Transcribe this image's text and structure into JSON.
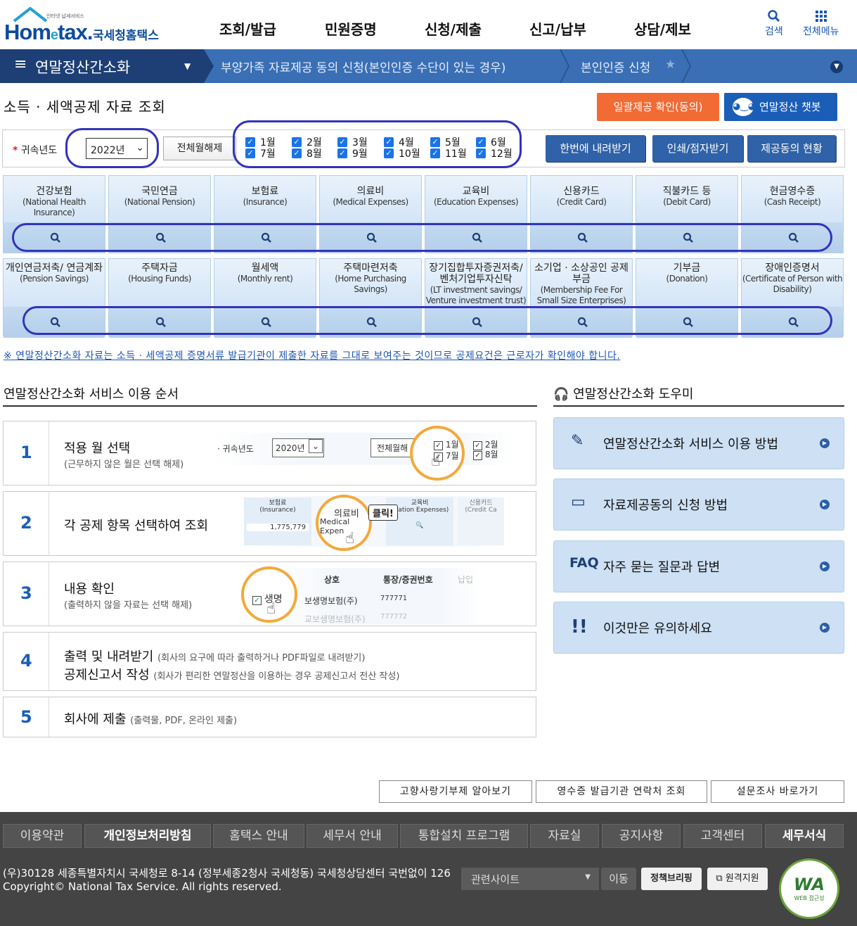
{
  "header": {
    "logo_sub": "인터넷 납세서비스",
    "logo_brand_a": "Hom",
    "logo_brand_e": "e",
    "logo_brand_b": "tax.",
    "logo_kr": "국세청홈택스",
    "menu": [
      "조회/발급",
      "민원증명",
      "신청/제출",
      "신고/납부",
      "상담/제보"
    ],
    "search_label": "검색",
    "allmenu_label": "전체메뉴"
  },
  "nav": {
    "current": "연말정산간소화",
    "crumbs": [
      "부양가족 자료제공 동의 신청(본인인증 수단이 있는 경우)",
      "본인인증 신청"
    ]
  },
  "page": {
    "title": "소득 · 세액공제 자료 조회",
    "bulk_confirm_button": "일괄제공 확인(동의)",
    "chatbot_button": "연말정산 챗봇"
  },
  "filter": {
    "year_label": "귀속년도",
    "year_value": "2022년",
    "all_off_button": "전체월해제",
    "months": [
      "1월",
      "2월",
      "3월",
      "4월",
      "5월",
      "6월",
      "7월",
      "8월",
      "9월",
      "10월",
      "11월",
      "12월"
    ],
    "download_all_button": "한번에 내려받기",
    "print_button": "인쇄/점자받기",
    "consent_status_button": "제공동의 현황"
  },
  "categories_row1": [
    {
      "kr": "건강보험",
      "en": "(National Health Insurance)"
    },
    {
      "kr": "국민연금",
      "en": "(National Pension)"
    },
    {
      "kr": "보험료",
      "en": "(Insurance)"
    },
    {
      "kr": "의료비",
      "en": "(Medical Expenses)"
    },
    {
      "kr": "교육비",
      "en": "(Education Expenses)"
    },
    {
      "kr": "신용카드",
      "en": "(Credit Card)"
    },
    {
      "kr": "직불카드 등",
      "en": "(Debit Card)"
    },
    {
      "kr": "현금영수증",
      "en": "(Cash Receipt)"
    }
  ],
  "categories_row2": [
    {
      "kr": "개인연금저축/ 연금계좌",
      "en": "(Pension Savings)"
    },
    {
      "kr": "주택자금",
      "en": "(Housing Funds)"
    },
    {
      "kr": "월세액",
      "en": "(Monthly rent)"
    },
    {
      "kr": "주택마련저축",
      "en": "(Home Purchasing Savings)"
    },
    {
      "kr": "장기집합투자증권저축/ 벤처기업투자신탁",
      "en": "(LT investment savings/ Venture investment trust)"
    },
    {
      "kr": "소기업 · 소상공인 공제부금",
      "en": "(Membership Fee For Small Size Enterprises)"
    },
    {
      "kr": "기부금",
      "en": "(Donation)"
    },
    {
      "kr": "장애인증명서",
      "en": "(Certificate of Person with Disability)"
    }
  ],
  "notice": "※ 연말정산간소화 자료는 소득 · 세액공제 증명서류 발급기관이 제출한 자료를 그대로 보여주는 것이므로 공제요건은 근로자가 확인해야 합니다.",
  "steps_title": "연말정산간소화 서비스 이용 순서",
  "steps": [
    {
      "num": "1",
      "title": "적용 월 선택",
      "desc": "(근무하지 않은 월은 선택 해제)"
    },
    {
      "num": "2",
      "title": "각 공제 항목 선택하여 조회",
      "desc": ""
    },
    {
      "num": "3",
      "title": "내용 확인",
      "desc": "(출력하지 않을 자료는 선택 해제)"
    },
    {
      "num": "4",
      "title": "출력 및 내려받기",
      "title2": "공제신고서 작성",
      "desc": "(회사의 요구에 따라 출력하거나 PDF파일로 내려받기)",
      "desc2": "(회사가 편리한 연말정산을 이용하는 경우 공제신고서 전산 작성)"
    },
    {
      "num": "5",
      "title": "회사에 제출",
      "desc": "(출력물, PDF, 온라인 제출)"
    }
  ],
  "illustrations": {
    "s1_year_label": "· 귀속년도",
    "s1_year": "2020년",
    "s1_alloff": "전체월해",
    "s1_m1": "1월",
    "s1_m7": "7월",
    "s1_m2": "2월",
    "s1_m8": "8월",
    "s2_c1_kr": "보험료",
    "s2_c1_en": "(Insurance)",
    "s2_c1_val": "1,775,779",
    "s2_c2_kr": "의료비",
    "s2_c2_en": "Medical Expen",
    "s2_click": "클릭!",
    "s2_c3_kr": "교육비",
    "s2_c3_en": "ucation Expenses)",
    "s2_c4_kr": "신용카드",
    "s2_c4_en": "(Credit Ca",
    "s3_h1": "상호",
    "s3_h2": "통장/증권번호",
    "s3_h3": "납입",
    "s3_name": "생명",
    "s3_r1": "보생명보험(주)",
    "s3_n1": "777771",
    "s3_r2": "교보생명보험(주)",
    "s3_n2": "777772"
  },
  "helper": {
    "title": "연말정산간소화 도우미",
    "items": [
      {
        "label": "연말정산간소화 서비스 이용 방법",
        "icon": "document-pen-icon"
      },
      {
        "label": "자료제공동의 신청 방법",
        "icon": "form-icon"
      },
      {
        "label": "자주 묻는 질문과 답변",
        "prefix": "FAQ",
        "icon": "faq-icon"
      },
      {
        "label": "이것만은 유의하세요",
        "icon": "exclamation-icon"
      }
    ]
  },
  "bottom_buttons": [
    "고향사랑기부제 알아보기",
    "영수증 발급기관 연락처 조회",
    "설문조사 바로가기"
  ],
  "footer": {
    "tabs": [
      "이용약관",
      "개인정보처리방침",
      "홈택스 안내",
      "세무서 안내",
      "통합설치 프로그램",
      "자료실",
      "공지사항",
      "고객센터",
      "세무서식"
    ],
    "address": "(우)30128 세종특별자치시 국세청로 8-14 (정부세종2청사 국세청동) 국세청상담센터 국번없이 126",
    "copyright": "Copyright© National Tax Service. All rights reserved.",
    "related_sites": "관련사이트",
    "go_button": "이동",
    "policy_brief": "정책브리핑",
    "remote_support": "원격지원",
    "wa_mark": "WA",
    "wa_sub": "WEB 접근성"
  },
  "colors": {
    "brand": "#0d4c9d",
    "nav_bar": "#3a6fb6",
    "nav_dark": "#1e3f75",
    "orange": "#f26a34",
    "card": "#cfe2f6",
    "oval": "#3333bb"
  }
}
